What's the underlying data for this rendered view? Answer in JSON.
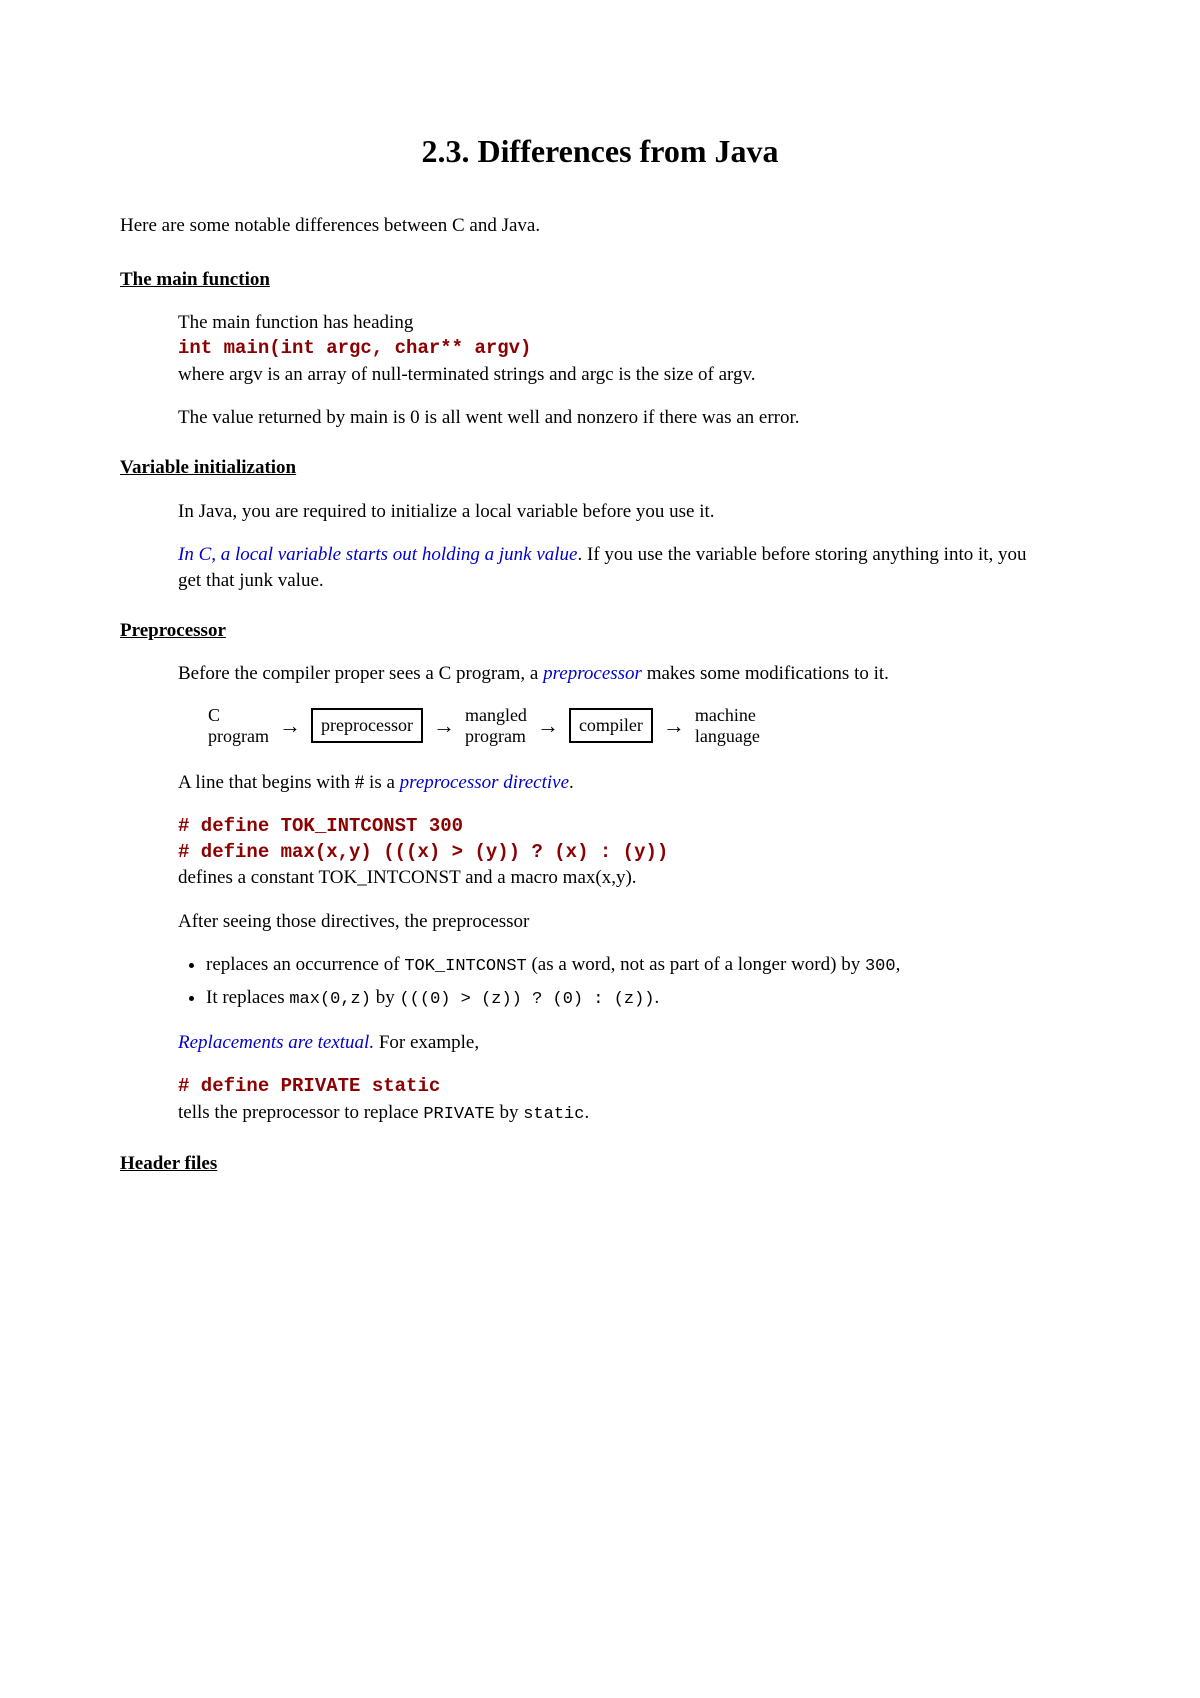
{
  "title": "2.3. Differences from Java",
  "intro": "Here are some notable differences between C and Java.",
  "sec_main": {
    "heading": "The main function",
    "p1": "The main function has heading",
    "code": "int main(int argc, char** argv)",
    "p2": "where argv is an array of null-terminated strings and argc is the size of argv.",
    "p3": "The value returned by main is 0 is all went well and nonzero if there was an error."
  },
  "sec_var": {
    "heading": "Variable initialization",
    "p1": "In Java, you are required to initialize a local variable before you use it.",
    "p2_emph": "In C, a local variable starts out holding a junk value",
    "p2_rest": ". If you use the variable before storing anything into it, you get that junk value."
  },
  "sec_pre": {
    "heading": "Preprocessor",
    "p1a": "Before the compiler proper sees a C program, a ",
    "p1_emph": "preprocessor",
    "p1b": " makes some modifications to it.",
    "diagram": {
      "n1a": "C",
      "n1b": "program",
      "n2": "preprocessor",
      "n3a": "mangled",
      "n3b": "program",
      "n4": "compiler",
      "n5a": "machine",
      "n5b": "language",
      "arrow": "→"
    },
    "p2a": "A line that begins with # is a ",
    "p2_emph": "preprocessor directive",
    "p2b": ".",
    "code1": "# define TOK_INTCONST 300",
    "code2": "# define max(x,y) (((x) > (y)) ? (x) : (y))",
    "p3": "defines a constant TOK_INTCONST and a macro max(x,y).",
    "p4": "After seeing those directives, the preprocessor",
    "li1a": "replaces an occurrence of ",
    "li1_mono1": "TOK_INTCONST",
    "li1b": " (as a word, not as part of a longer word) by ",
    "li1_mono2": "300",
    "li1c": ",",
    "li2a": "It replaces ",
    "li2_mono1": "max(0,z)",
    "li2b": " by ",
    "li2_mono2": "(((0) > (z)) ? (0) : (z))",
    "li2c": ".",
    "p5_emph": "Replacements are textual.",
    "p5_rest": " For example,",
    "code3": "# define PRIVATE static",
    "p6a": "tells the preprocessor to replace ",
    "p6_mono1": "PRIVATE",
    "p6b": " by ",
    "p6_mono2": "static",
    "p6c": "."
  },
  "sec_header": {
    "heading": "Header files"
  }
}
